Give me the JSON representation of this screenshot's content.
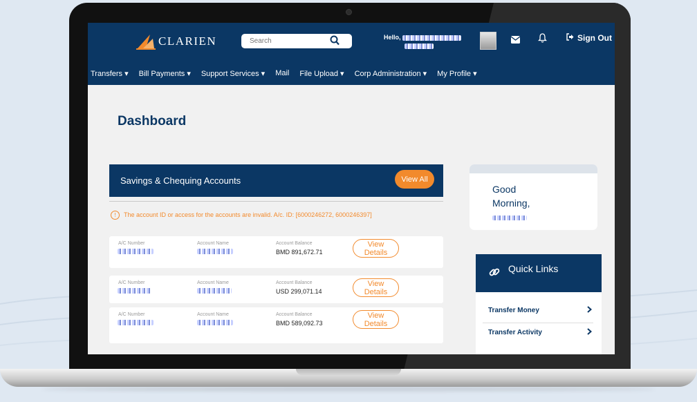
{
  "header": {
    "brand": "CLARIEN",
    "search_placeholder": "Search",
    "hello": "Hello,",
    "sign_out": "Sign Out"
  },
  "menu": [
    {
      "label": "Transfers",
      "dropdown": true
    },
    {
      "label": "Bill Payments",
      "dropdown": true
    },
    {
      "label": "Support Services",
      "dropdown": true
    },
    {
      "label": "Mail",
      "dropdown": false
    },
    {
      "label": "File Upload",
      "dropdown": true
    },
    {
      "label": "Corp Administration",
      "dropdown": true
    },
    {
      "label": "My Profile",
      "dropdown": true
    }
  ],
  "dashboard": {
    "title": "Dashboard",
    "savings": {
      "title": "Savings & Chequing Accounts",
      "view_all": "View All",
      "warning": "The account ID or access for the accounts are invalid. A/c. ID: [6000246272, 6000246397]",
      "labels": {
        "acct_number": "A/C Number",
        "acct_name": "Account Name",
        "acct_balance": "Account Balance",
        "view_details": "View Details"
      },
      "accounts": [
        {
          "balance": "BMD 891,672.71"
        },
        {
          "balance": "USD 299,071.14"
        },
        {
          "balance": "BMD 589,092.73"
        }
      ]
    }
  },
  "greeting": {
    "line1": "Good",
    "line2": "Morning,"
  },
  "quick_links": {
    "title": "Quick Links",
    "items": [
      "Transfer Money",
      "Transfer Activity"
    ]
  },
  "colors": {
    "brand_navy": "#0b3764",
    "accent_orange": "#f28a2c"
  }
}
